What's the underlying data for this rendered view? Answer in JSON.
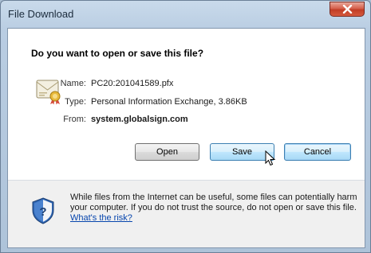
{
  "window": {
    "title": "File Download"
  },
  "dialog": {
    "heading": "Do you want to open or save this file?",
    "fields": [
      {
        "label": "Name:",
        "value": "PC20:201041589.pfx"
      },
      {
        "label": "Type:",
        "value": "Personal Information Exchange, 3.86KB"
      },
      {
        "label": "From:",
        "value": "system.globalsign.com"
      }
    ],
    "buttons": {
      "open": "Open",
      "save": "Save",
      "cancel": "Cancel"
    }
  },
  "footer": {
    "warning_text": "While files from the Internet can be useful, some files can potentially harm your computer. If you do not trust the source, do not open or save this file.",
    "risk_link": "What's the risk?"
  },
  "icons": {
    "close": "close-icon",
    "file": "certificate-file-icon",
    "shield": "security-shield-icon",
    "cursor": "mouse-pointer-icon"
  },
  "colors": {
    "title_bar": "#b9cde2",
    "close_button": "#c13d25",
    "link": "#0645ad",
    "focus_border": "#3c7fb1"
  }
}
